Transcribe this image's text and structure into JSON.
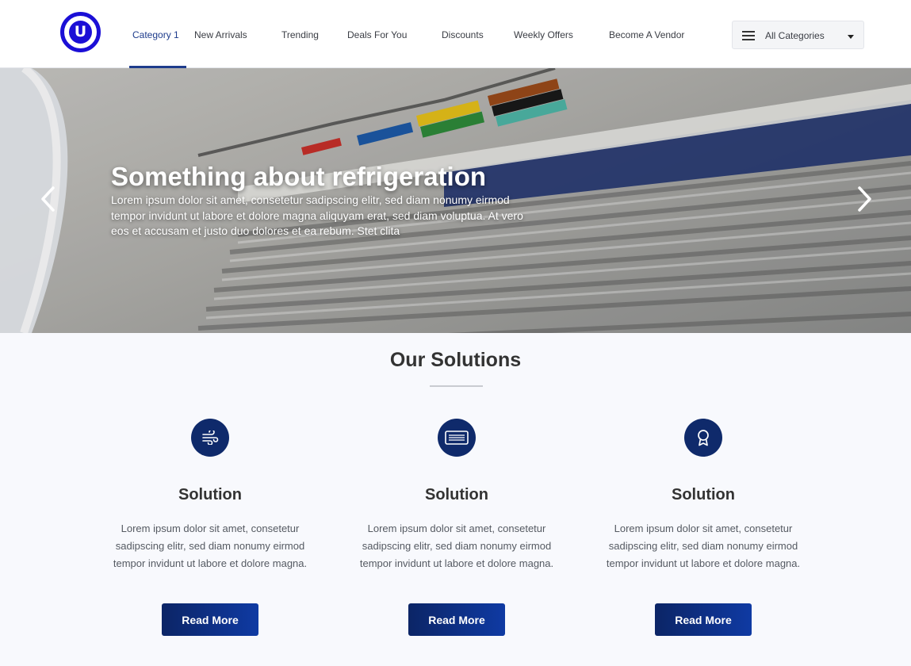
{
  "header": {
    "logo_letter": "U",
    "nav": [
      {
        "label": "Category 1"
      },
      {
        "label": "New Arrivals"
      },
      {
        "label": "Trending"
      },
      {
        "label": "Deals For You"
      },
      {
        "label": "Discounts"
      },
      {
        "label": "Weekly Offers"
      },
      {
        "label": "Become A Vendor"
      }
    ],
    "active_nav": "Category 1",
    "category_select": {
      "label": "All Categories"
    }
  },
  "hero": {
    "title": "Something about refrigeration",
    "text": "Lorem ipsum dolor sit amet, consetetur sadipscing elitr, sed diam nonumy eirmod tempor invidunt ut labore et dolore magna aliquyam erat, sed diam voluptua. At vero eos et accusam et justo duo dolores et ea rebum. Stet clita"
  },
  "solutions": {
    "title": "Our Solutions",
    "cards": [
      {
        "icon": "wind-icon",
        "title": "Solution",
        "text": "Lorem ipsum dolor sit amet, consetetur sadipscing elitr, sed diam nonumy eirmod tempor invidunt ut labore et dolore magna.",
        "button": "Read More"
      },
      {
        "icon": "air-conditioner-icon",
        "title": "Solution",
        "text": "Lorem ipsum dolor sit amet, consetetur sadipscing elitr, sed diam nonumy eirmod tempor invidunt ut labore et dolore magna.",
        "button": "Read More"
      },
      {
        "icon": "award-icon",
        "title": "Solution",
        "text": "Lorem ipsum dolor sit amet, consetetur sadipscing elitr, sed diam nonumy eirmod tempor invidunt ut labore et dolore magna.",
        "button": "Read More"
      }
    ]
  },
  "colors": {
    "brand": "#1b0fd6",
    "accent": "#1e3c8c",
    "icon_bg": "#0f2a6b",
    "button": "#0c2566",
    "page_bg": "#f8f9fd"
  }
}
